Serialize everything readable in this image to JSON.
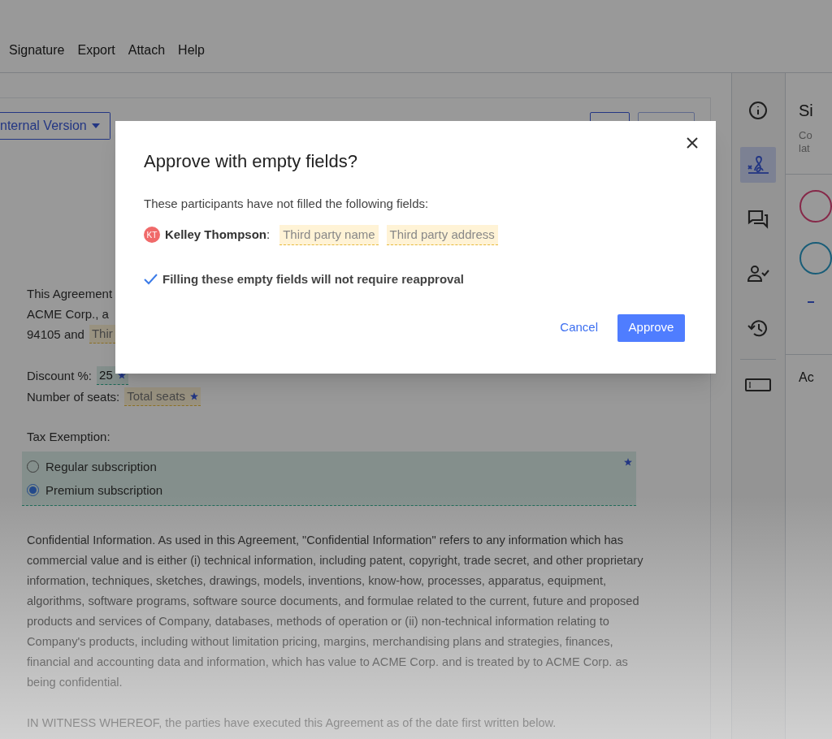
{
  "menu": [
    "Signature",
    "Export",
    "Attach",
    "Help"
  ],
  "toolbar": {
    "version_button": "nternal Version"
  },
  "document": {
    "intro_lines": [
      "This Agreement",
      "ACME Corp., a"
    ],
    "partial_line": {
      "text": "94105 and",
      "field": "Thir"
    },
    "fields": [
      {
        "label": "Discount %:",
        "value": "25",
        "filled": true,
        "required": true
      },
      {
        "label": "Number of seats:",
        "placeholder": "Total seats",
        "filled": false,
        "required": true
      }
    ],
    "tax_exemption": {
      "label": "Tax Exemption:",
      "required": true,
      "options": [
        {
          "label": "Regular subscription",
          "selected": false
        },
        {
          "label": "Premium subscription",
          "selected": true
        }
      ]
    },
    "paragraphs": [
      "Confidential Information. As used in this Agreement, \"Confidential Information\" refers to any information which has commercial value and is either (i) technical information, including patent, copyright, trade secret, and other proprietary information, techniques, sketches, drawings, models, inventions, know-how, processes, apparatus, equipment, algorithms, software programs, software source documents, and formulae related to the current, future and proposed products and services of Company, databases, methods of operation or (ii) non-technical information relating to Company's products, including without limitation pricing, margins, merchandising plans and strategies, finances, financial and accounting data and information, which has value to ACME Corp. and is treated by to ACME Corp. as being confidential.",
      "IN WITNESS WHEREOF, the parties have executed this Agreement as of the date first written below."
    ]
  },
  "rail": [
    {
      "kind": "info",
      "selected": false
    },
    {
      "kind": "signature",
      "selected": true
    },
    {
      "kind": "chat",
      "selected": false
    },
    {
      "kind": "person-check",
      "selected": false
    },
    {
      "kind": "history",
      "selected": false
    },
    {
      "kind": "text-field",
      "selected": false
    }
  ],
  "side_panel": {
    "title": "Si",
    "description_lines": [
      "Co",
      "lat"
    ],
    "section": "Ac"
  },
  "dialog": {
    "title": "Approve with empty fields?",
    "message": "These participants have not filled the following fields:",
    "participants": [
      {
        "initials": "KT",
        "color": "#f06a6a",
        "name": "**Kelley Thompson**:",
        "fields": [
          "Third party name",
          "Third party address"
        ]
      }
    ],
    "note": "Filling these empty fields will not require reapproval",
    "cancel": "Cancel",
    "approve": "Approve"
  }
}
